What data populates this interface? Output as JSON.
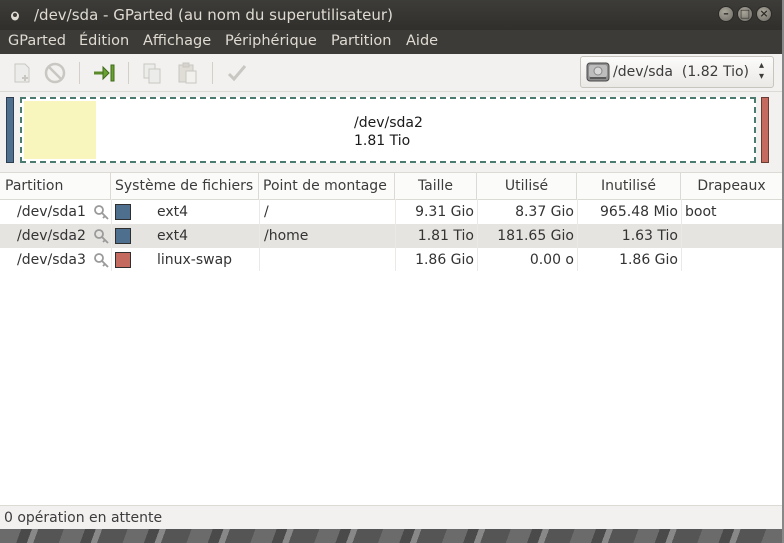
{
  "window": {
    "title": "/dev/sda - GParted (au nom du superutilisateur)"
  },
  "menubar": {
    "items": [
      "GParted",
      "Édition",
      "Affichage",
      "Périphérique",
      "Partition",
      "Aide"
    ]
  },
  "toolbar": {
    "buttons": [
      "new-partition-icon",
      "delete-icon",
      "resize-move-icon",
      "copy-icon",
      "paste-icon",
      "apply-icon"
    ],
    "device_selector": "/dev/sda  (1.82 Tio)"
  },
  "disk_map": {
    "partition_name": "/dev/sda2",
    "partition_size": "1.81 Tio",
    "used_color": "#f8f6bd"
  },
  "table": {
    "columns": [
      "Partition",
      "Système de fichiers",
      "Point de montage",
      "Taille",
      "Utilisé",
      "Inutilisé",
      "Drapeaux"
    ],
    "rows": [
      {
        "partition": "/dev/sda1",
        "fs": "ext4",
        "fs_color": "#4f6f8f",
        "mount": "/",
        "size": "9.31 Gio",
        "used": "8.37 Gio",
        "unused": "965.48 Mio",
        "flags": "boot"
      },
      {
        "partition": "/dev/sda2",
        "fs": "ext4",
        "fs_color": "#4f6f8f",
        "mount": "/home",
        "size": "1.81 Tio",
        "used": "181.65 Gio",
        "unused": "1.63 Tio",
        "flags": ""
      },
      {
        "partition": "/dev/sda3",
        "fs": "linux-swap",
        "fs_color": "#c56a5e",
        "mount": "",
        "size": "1.86 Gio",
        "used": "0.00 o",
        "unused": "1.86 Gio",
        "flags": ""
      }
    ]
  },
  "statusbar": {
    "text": "0 opération en attente"
  }
}
